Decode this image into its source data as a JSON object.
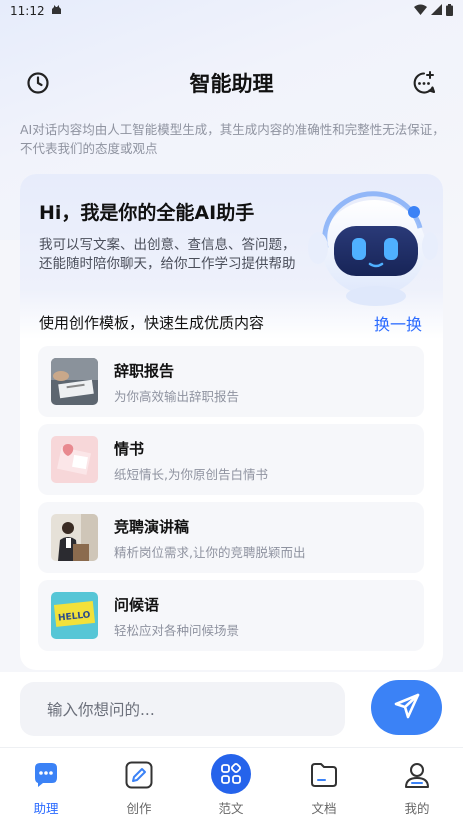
{
  "status": {
    "time": "11:12"
  },
  "header": {
    "title": "智能助理"
  },
  "disclaimer": "AI对话内容均由人工智能模型生成，其生成内容的准确性和完整性无法保证，不代表我们的态度或观点",
  "card": {
    "greeting": "Hi，我是你的全能AI助手",
    "intro": "我可以写文案、出创意、查信息、答问题，还能随时陪你聊天，给你工作学习提供帮助",
    "templates_title": "使用创作模板，快速生成优质内容",
    "refresh_label": "换一换",
    "templates": [
      {
        "title": "辞职报告",
        "desc": "为你高效输出辞职报告",
        "thumb": "resignation-image"
      },
      {
        "title": "情书",
        "desc": "纸短情长,为你原创告白情书",
        "thumb": "love-letter-image"
      },
      {
        "title": "竞聘演讲稿",
        "desc": "精析岗位需求,让你的竞聘脱颖而出",
        "thumb": "speech-image"
      },
      {
        "title": "问候语",
        "desc": "轻松应对各种问候场景",
        "thumb": "hello-image"
      }
    ]
  },
  "input": {
    "placeholder": "输入你想问的..."
  },
  "tabs": [
    {
      "label": "助理",
      "icon": "chat-icon",
      "active": true
    },
    {
      "label": "创作",
      "icon": "pen-icon",
      "active": false
    },
    {
      "label": "范文",
      "icon": "grid-icon",
      "active": false
    },
    {
      "label": "文档",
      "icon": "folder-icon",
      "active": false
    },
    {
      "label": "我的",
      "icon": "user-icon",
      "active": false
    }
  ],
  "colors": {
    "accent": "#2b6bff",
    "send": "#3b82f6",
    "background": "#f5f6fa"
  }
}
